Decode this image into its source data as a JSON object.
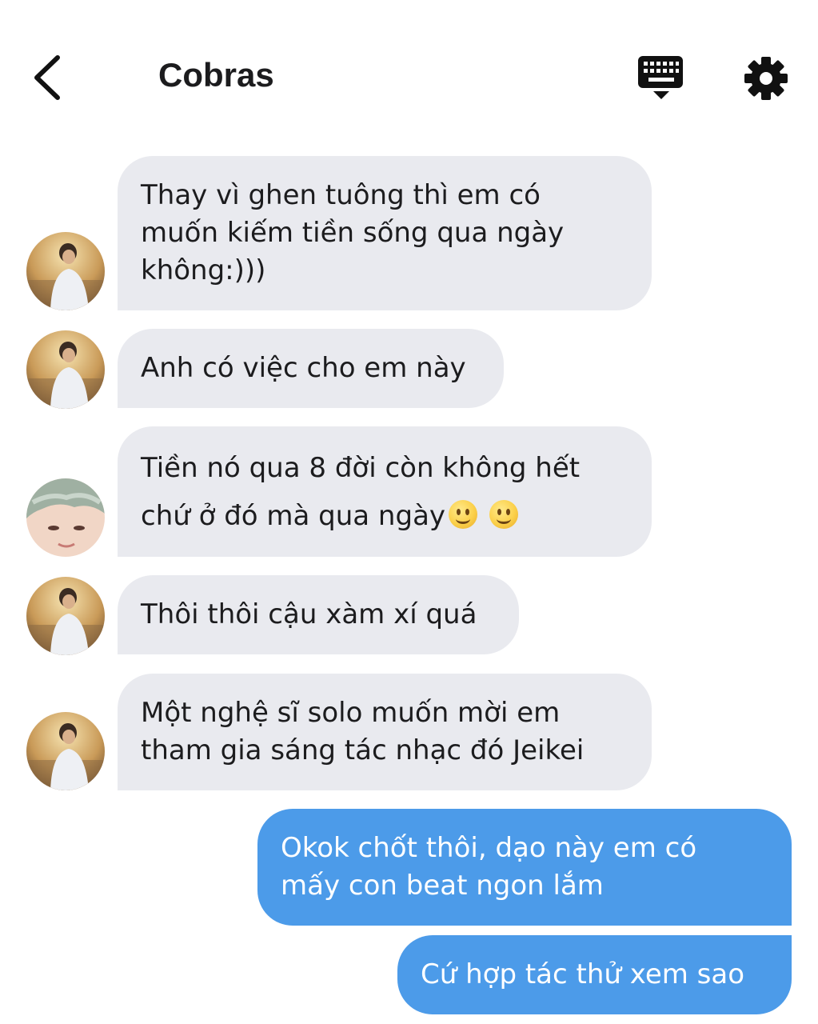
{
  "header": {
    "title": "Cobras",
    "back_icon": "chevron-left-icon",
    "keyboard_icon": "keyboard-icon",
    "settings_icon": "gear-icon"
  },
  "colors": {
    "incoming_bubble": "#e9eaef",
    "outgoing_bubble": "#4c9be9",
    "text": "#1c1c1e"
  },
  "messages": [
    {
      "direction": "incoming",
      "lines": [
        "Thay vì ghen tuông thì em có",
        "muốn kiếm tiền sống qua ngày",
        "không:)))"
      ]
    },
    {
      "direction": "incoming",
      "lines": [
        "Anh có việc cho em này"
      ]
    },
    {
      "direction": "incoming",
      "lines": [
        "Tiền nó qua 8 đời còn không hết",
        "chứ ở đó mà qua ngày"
      ],
      "emoji": [
        "slightly-smiling-face",
        "slightly-smiling-face"
      ]
    },
    {
      "direction": "incoming",
      "lines": [
        "Thôi thôi cậu xàm xí quá"
      ]
    },
    {
      "direction": "incoming",
      "lines": [
        "Một nghệ sĩ solo muốn mời em",
        "tham gia sáng tác nhạc đó Jeikei"
      ]
    },
    {
      "direction": "outgoing",
      "lines": [
        "Okok chốt thôi, dạo này em có",
        "mấy con beat ngon lắm"
      ]
    },
    {
      "direction": "outgoing",
      "lines": [
        "Cứ hợp tác thử xem sao"
      ]
    }
  ]
}
